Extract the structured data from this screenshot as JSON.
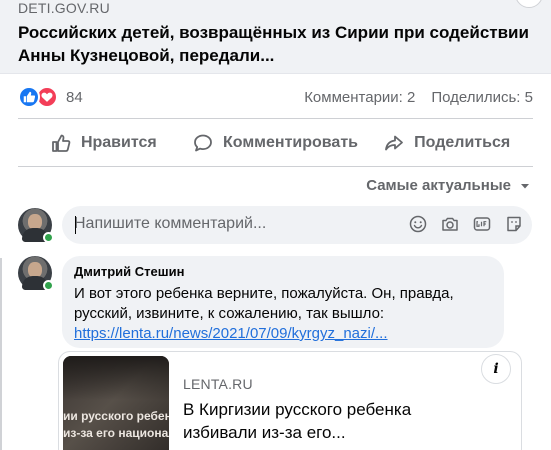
{
  "link_preview": {
    "domain": "DETI.GOV.RU",
    "title": "Российских детей, возвращённых из Сирии при содействии Анны Кузнецовой, передали..."
  },
  "reactions": {
    "icons": [
      "like-icon",
      "love-icon"
    ],
    "count": "84",
    "comments_label": "Комментарии: 2",
    "shares_label": "Поделились: 5"
  },
  "actions": {
    "like": "Нравится",
    "comment": "Комментировать",
    "share": "Поделиться"
  },
  "sort": {
    "label": "Самые актуальные"
  },
  "composer": {
    "placeholder": "Напишите комментарий...",
    "icons": [
      "emoji-icon",
      "camera-icon",
      "gif-icon",
      "sticker-icon"
    ]
  },
  "comment": {
    "author": "Дмитрий Стешин",
    "text": "И вот этого ребенка верните, пожалуйста. Он, правда, русский, извините, к сожалению, так вышло:",
    "link": "https://lenta.ru/news/2021/07/09/kyrgyz_nazi/..."
  },
  "shared_card": {
    "thumb_line1": "ии русского ребенка",
    "thumb_line2": "из-за его националь",
    "domain": "LENTA.RU",
    "title": "В Киргизии русского ребенка избивали из-за его...",
    "info_label": "i"
  },
  "colors": {
    "like_blue": "#1877f2",
    "love_red": "#f33e58",
    "link_blue": "#216fdb",
    "online_green": "#31a24c"
  }
}
